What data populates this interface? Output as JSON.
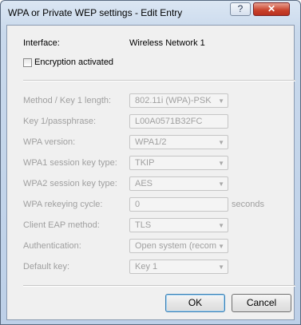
{
  "window": {
    "title": "WPA or Private WEP settings - Edit Entry",
    "help_label": "?",
    "close_label": "✕"
  },
  "interface": {
    "label": "Interface:",
    "value": "Wireless Network 1"
  },
  "encryption": {
    "label": "Encryption activated",
    "checked": false
  },
  "fields": {
    "method": {
      "label": "Method / Key 1 length:",
      "value": "802.11i (WPA)-PSK"
    },
    "key": {
      "label": "Key 1/passphrase:",
      "value": "L00A0571B32FC"
    },
    "wpa_version": {
      "label": "WPA version:",
      "value": "WPA1/2"
    },
    "wpa1_session": {
      "label": "WPA1 session key type:",
      "value": "TKIP"
    },
    "wpa2_session": {
      "label": "WPA2 session key type:",
      "value": "AES"
    },
    "rekeying": {
      "label": "WPA rekeying cycle:",
      "value": "0",
      "unit": "seconds"
    },
    "eap": {
      "label": "Client EAP method:",
      "value": "TLS"
    },
    "auth": {
      "label": "Authentication:",
      "value": "Open system (recom"
    },
    "default_key": {
      "label": "Default key:",
      "value": "Key 1"
    }
  },
  "buttons": {
    "ok": "OK",
    "cancel": "Cancel"
  }
}
